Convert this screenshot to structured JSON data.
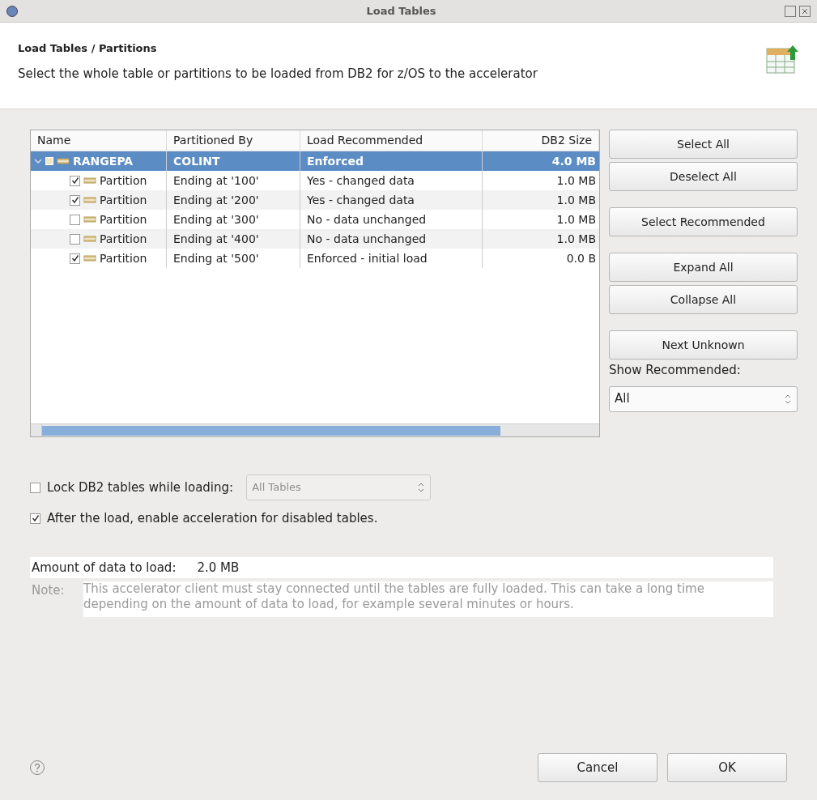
{
  "window": {
    "title": "Load Tables"
  },
  "header": {
    "title": "Load Tables / Partitions",
    "description": "Select the whole table or partitions to be loaded from DB2 for z/OS to the accelerator"
  },
  "table": {
    "columns": [
      "Name",
      "Partitioned By",
      "Load Recommended",
      "DB2 Size"
    ],
    "rows": [
      {
        "name": "RANGEPA",
        "partitioned_by": "COLINT",
        "load_recommended": "Enforced",
        "size": "4.0 MB",
        "selected": true,
        "expanded": true,
        "children": [
          {
            "name": "Partition",
            "partitioned_by": "Ending at '100'",
            "load_recommended": "Yes - changed data",
            "size": "1.0 MB",
            "checked": true,
            "selected": false
          },
          {
            "name": "Partition",
            "partitioned_by": "Ending at '200'",
            "load_recommended": "Yes - changed data",
            "size": "1.0 MB",
            "checked": true,
            "selected": false
          },
          {
            "name": "Partition",
            "partitioned_by": "Ending at '300'",
            "load_recommended": "No - data unchanged",
            "size": "1.0 MB",
            "checked": false,
            "selected": false
          },
          {
            "name": "Partition",
            "partitioned_by": "Ending at '400'",
            "load_recommended": "No - data unchanged",
            "size": "1.0 MB",
            "checked": false,
            "selected": false
          },
          {
            "name": "Partition",
            "partitioned_by": "Ending at '500'",
            "load_recommended": "Enforced - initial load",
            "size": "0.0 B",
            "checked": true,
            "selected": false
          }
        ]
      }
    ]
  },
  "side_button_groups": [
    [
      "Select All",
      "Deselect All"
    ],
    [
      "Select Recommended"
    ],
    [
      "Expand All",
      "Collapse All"
    ],
    [
      "Next Unknown"
    ]
  ],
  "show_recommended": {
    "label": "Show Recommended:",
    "value": "All"
  },
  "options": [
    {
      "label": "Lock DB2 tables while loading:",
      "checked": false,
      "select": {
        "value": "All Tables",
        "disabled": true
      }
    },
    {
      "label": "After the load, enable acceleration for disabled tables.",
      "checked": true
    }
  ],
  "amount": {
    "label": "Amount of data to load:",
    "value": "2.0 MB"
  },
  "note": {
    "label": "Note:",
    "text": "This accelerator client must stay connected until the tables are fully loaded. This can take a long time depending on the amount of data to load, for example several minutes or hours."
  },
  "footer": {
    "buttons": [
      "Cancel",
      "OK"
    ]
  }
}
